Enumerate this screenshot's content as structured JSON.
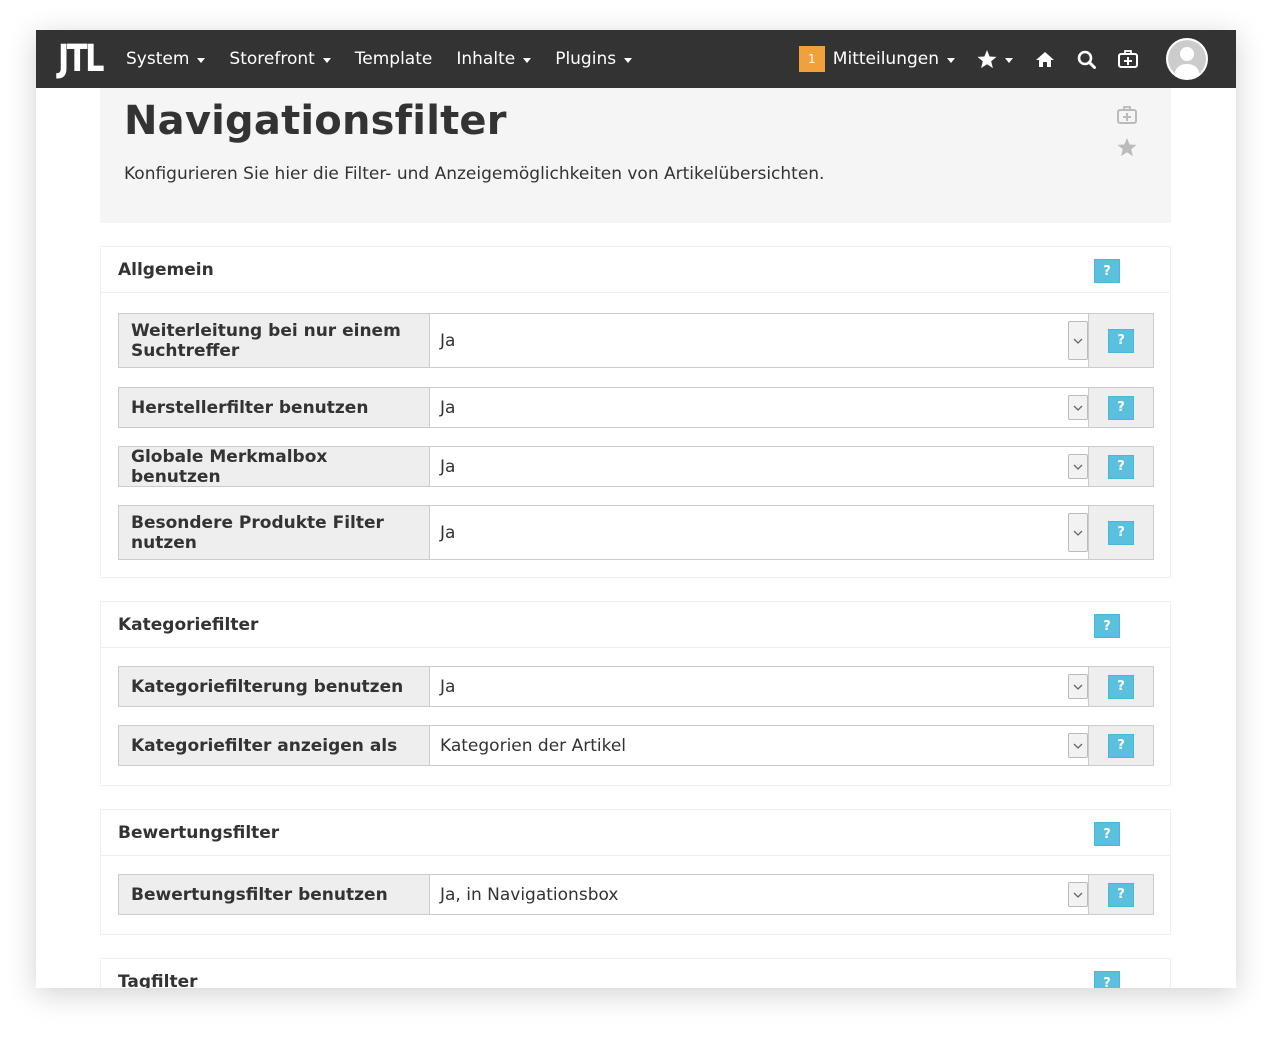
{
  "navbar": {
    "logo": "JTL",
    "menu": [
      {
        "label": "System",
        "dropdown": true
      },
      {
        "label": "Storefront",
        "dropdown": true
      },
      {
        "label": "Template",
        "dropdown": false
      },
      {
        "label": "Inhalte",
        "dropdown": true
      },
      {
        "label": "Plugins",
        "dropdown": true
      }
    ],
    "notifications_count": "1",
    "notifications_label": "Mitteilungen",
    "icons": [
      "star-icon",
      "home-icon",
      "search-icon",
      "medkit-icon",
      "user-avatar"
    ]
  },
  "page": {
    "title": "Navigationsfilter",
    "subtitle": "Konfigurieren Sie hier die Filter- und Anzeigemöglichkeiten von Artikelübersichten."
  },
  "sections": [
    {
      "title": "Allgemein",
      "help": "?",
      "settings": [
        {
          "label": "Weiterleitung bei nur einem Suchtreffer",
          "value": "Ja",
          "help": "?"
        },
        {
          "label": "Herstellerfilter benutzen",
          "value": "Ja",
          "help": "?"
        },
        {
          "label": "Globale Merkmalbox benutzen",
          "value": "Ja",
          "help": "?"
        },
        {
          "label": "Besondere Produkte Filter nutzen",
          "value": "Ja",
          "help": "?"
        }
      ]
    },
    {
      "title": "Kategoriefilter",
      "help": "?",
      "settings": [
        {
          "label": "Kategoriefilterung benutzen",
          "value": "Ja",
          "help": "?"
        },
        {
          "label": "Kategoriefilter anzeigen als",
          "value": "Kategorien der Artikel",
          "help": "?"
        }
      ]
    },
    {
      "title": "Bewertungsfilter",
      "help": "?",
      "settings": [
        {
          "label": "Bewertungsfilter benutzen",
          "value": "Ja, in Navigationsbox",
          "help": "?"
        }
      ]
    },
    {
      "title": "Tagfilter",
      "help": "?",
      "settings": []
    }
  ],
  "colors": {
    "navbar_bg": "#333333",
    "badge_bg": "#f0a13b",
    "help_bg": "#5bc0de",
    "label_bg": "#eeeeee",
    "header_bg": "#f5f5f5"
  }
}
